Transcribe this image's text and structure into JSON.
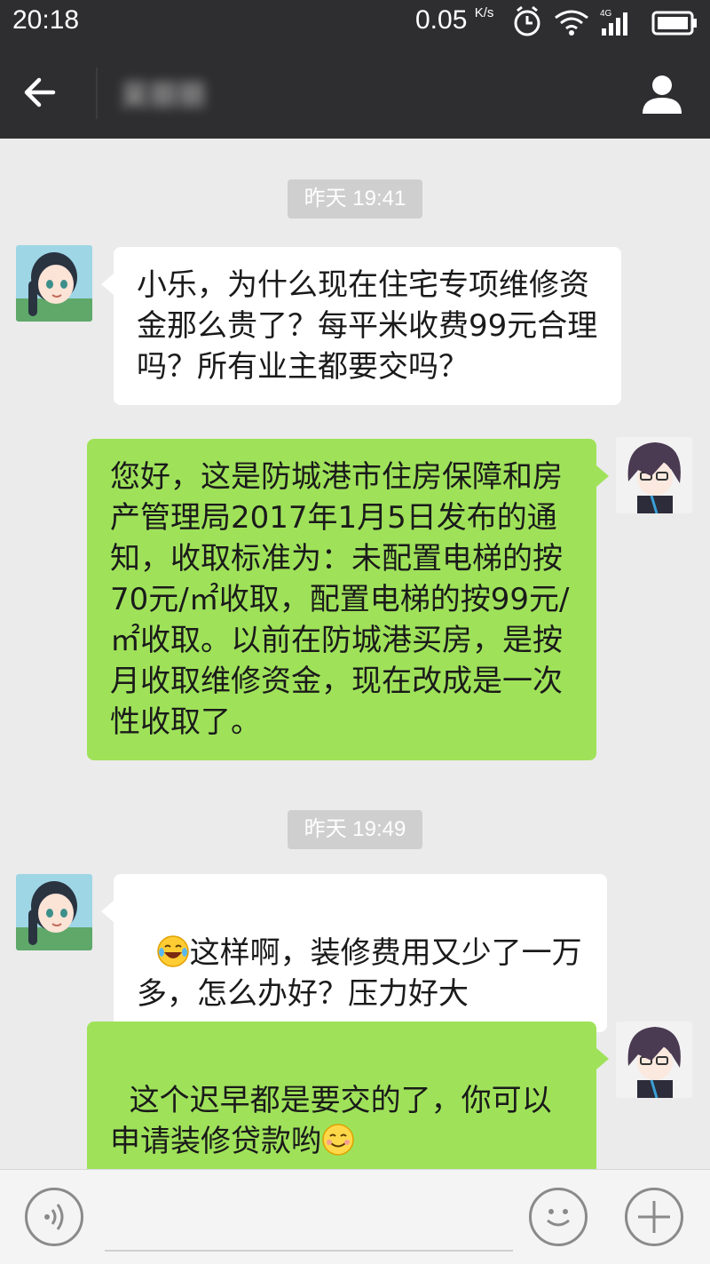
{
  "status_bar": {
    "time": "20:18",
    "speed": "0.05",
    "speed_unit": "K/s",
    "network": "4G"
  },
  "header": {
    "back_icon": "arrow-left-icon",
    "contact_name": "吴丽丽",
    "profile_icon": "person-icon"
  },
  "messages": [
    {
      "type": "time",
      "text": "昨天 19:41"
    },
    {
      "type": "incoming",
      "text": "小乐，为什么现在住宅专项维修资金那么贵了？每平米收费99元合理吗？所有业主都要交吗？"
    },
    {
      "type": "outgoing",
      "text": "您好，这是防城港市住房保障和房产管理局2017年1月5日发布的通知，收取标准为：未配置电梯的按70元/㎡收取，配置电梯的按99元/㎡收取。以前在防城港买房，是按月收取维修资金，现在改成是一次性收取了。"
    },
    {
      "type": "time",
      "text": "昨天 19:49"
    },
    {
      "type": "incoming",
      "emoji": "laughing-tears-emoji",
      "text": "这样啊，装修费用又少了一万多，怎么办好？压力好大"
    },
    {
      "type": "outgoing",
      "text": "这个迟早都是要交的了，你可以申请装修贷款哟",
      "emoji": "smile-emoji"
    }
  ],
  "input_bar": {
    "voice_icon": "voice-icon",
    "input_value": "",
    "emoji_icon": "emoji-icon",
    "more_icon": "plus-icon"
  },
  "colors": {
    "header_bg": "#2e2e30",
    "chat_bg": "#ebebeb",
    "outgoing_bubble": "#9fe25a",
    "incoming_bubble": "#ffffff"
  }
}
